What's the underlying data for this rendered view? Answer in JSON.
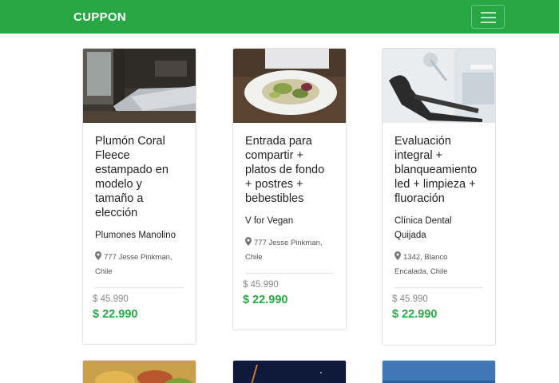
{
  "navbar": {
    "brand": "CUPPON",
    "menu_icon": "hamburger-menu-icon"
  },
  "colors": {
    "brand": "#28a745",
    "price": "#28a745"
  },
  "cards": [
    {
      "title": "Plumón Coral Fleece estampado en modelo y tamaño a elección",
      "merchant": "Plumones Manolino",
      "address": "777 Jesse Pinkman, Chile",
      "old_price": "$ 45.990",
      "new_price": "$ 22.990",
      "image": "bedroom-photo"
    },
    {
      "title": "Entrada para compartir + platos de fondo + postres + bebestibles",
      "merchant": "V for Vegan",
      "address": "777 Jesse Pinkman, Chile",
      "old_price": "$ 45.990",
      "new_price": "$ 22.990",
      "image": "salad-plate-photo"
    },
    {
      "title": "Evaluación integral + blanqueamiento led + limpieza + fluoración",
      "merchant": "Clínica Dental Quijada",
      "address": "1342, Blanco Encalada, Chile",
      "old_price": "$ 45.990",
      "new_price": "$ 22.990",
      "image": "dental-chair-photo"
    }
  ]
}
